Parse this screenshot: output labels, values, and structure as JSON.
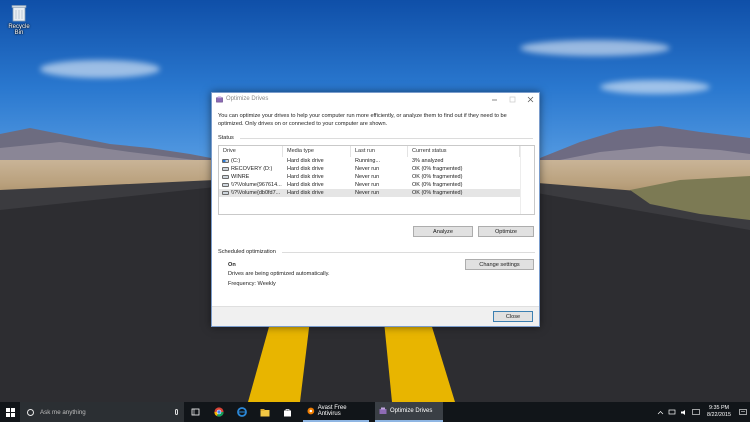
{
  "desktop": {
    "recycle_bin_label": "Recycle Bin"
  },
  "window": {
    "title": "Optimize Drives",
    "description": "You can optimize your drives to help your computer run more efficiently, or analyze them to find out if they need to be optimized. Only drives on or connected to your computer are shown.",
    "status_label": "Status",
    "columns": [
      "Drive",
      "Media type",
      "Last run",
      "Current status"
    ],
    "drives": [
      {
        "drive": "(C:)",
        "media_type": "Hard disk drive",
        "last_run": "Running...",
        "status": "3% analyzed",
        "icon": "system-drive-icon"
      },
      {
        "drive": "RECOVERY (D:)",
        "media_type": "Hard disk drive",
        "last_run": "Never run",
        "status": "OK (0% fragmented)",
        "icon": "drive-icon"
      },
      {
        "drive": "WINRE",
        "media_type": "Hard disk drive",
        "last_run": "Never run",
        "status": "OK (0% fragmented)",
        "icon": "drive-icon"
      },
      {
        "drive": "\\\\?\\Volume{967614...",
        "media_type": "Hard disk drive",
        "last_run": "Never run",
        "status": "OK (0% fragmented)",
        "icon": "drive-icon"
      },
      {
        "drive": "\\\\?\\Volume{db0fd7...",
        "media_type": "Hard disk drive",
        "last_run": "Never run",
        "status": "OK (0% fragmented)",
        "icon": "drive-icon"
      }
    ],
    "analyze_label": "Analyze",
    "optimize_label": "Optimize",
    "scheduled_label": "Scheduled optimization",
    "schedule_state": "On",
    "schedule_desc": "Drives are being optimized automatically.",
    "frequency": "Frequency: Weekly",
    "change_settings_label": "Change settings",
    "close_label": "Close"
  },
  "taskbar": {
    "search_placeholder": "Ask me anything",
    "apps": [
      {
        "label": "Avast Free Antivirus",
        "color": "#f07d00"
      },
      {
        "label": "Optimize Drives",
        "color": "#3a3f45"
      }
    ],
    "time": "9:35 PM",
    "date": "8/22/2015"
  },
  "colors": {
    "taskbar": "#111519",
    "window_border": "#7a9ccc",
    "avast": "#f07d00"
  }
}
